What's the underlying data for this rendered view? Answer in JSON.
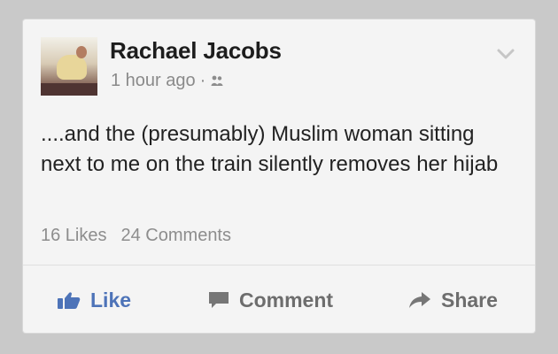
{
  "post": {
    "author": "Rachael Jacobs",
    "timestamp": "1 hour ago",
    "separator": "·",
    "audience_icon": "friends-icon",
    "text": "....and the (presumably) Muslim woman sitting next to me on the train silently removes her hijab",
    "likes_label": "16 Likes",
    "comments_label": "24 Comments"
  },
  "actions": {
    "like_label": "Like",
    "comment_label": "Comment",
    "share_label": "Share"
  },
  "colors": {
    "page_background": "#c9c9c9",
    "card_background": "#f4f4f4",
    "accent": "#4d73b8",
    "text_primary": "#222222",
    "text_muted": "#8a8a8a"
  }
}
